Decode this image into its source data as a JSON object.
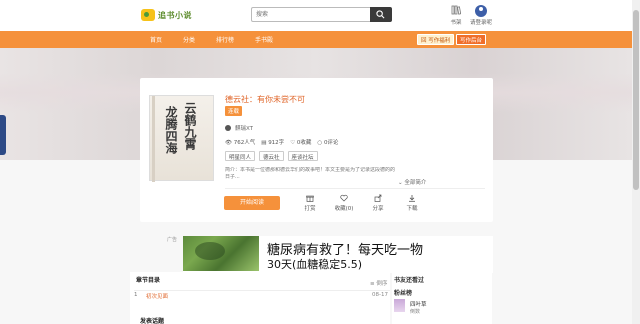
{
  "header": {
    "logo_text": "追书小说",
    "search_placeholder": "搜索",
    "shelf_label": "书架",
    "user_label": "请登录呢"
  },
  "nav": {
    "items": [
      "首页",
      "分类",
      "排行榜",
      "手书殿"
    ],
    "btn_welfare": "回 写作福利",
    "btn_backend": "写作后台"
  },
  "book": {
    "cover_right": "云鹤九霄",
    "cover_left": "龙腾四海",
    "title": "德云社：有你未尝不可",
    "status": "连载",
    "author": "麒瑞XT",
    "stats": {
      "popularity": "762人气",
      "words": "912字",
      "collect": "0收藏",
      "comments": "0评论"
    },
    "tags": [
      "明星同人",
      "德云社",
      "座谈社坛"
    ],
    "intro": "简介：本书是一位德那和德云华们的故事吧！本文主要是为了记录这段德的的日子...",
    "intro_toggle": "全部简介",
    "read_button": "开始阅读",
    "actions": [
      "打赏",
      "收藏(0)",
      "分享",
      "下载"
    ]
  },
  "ad": {
    "marker": "广告",
    "line1": "糖尿病有救了！每天吃一物",
    "line2": "30天(血糖稳定5.5)"
  },
  "chapters": {
    "heading": "章节目录",
    "sort_label": "倒序",
    "rows": [
      {
        "num": "1",
        "name": "初次见面",
        "date": "08-17"
      }
    ]
  },
  "discussion_heading": "发表话题",
  "right_panel": {
    "heading1": "书友还看过",
    "heading2": "粉丝榜",
    "fan_name": "四叶草",
    "fan_rank": "倒数"
  }
}
